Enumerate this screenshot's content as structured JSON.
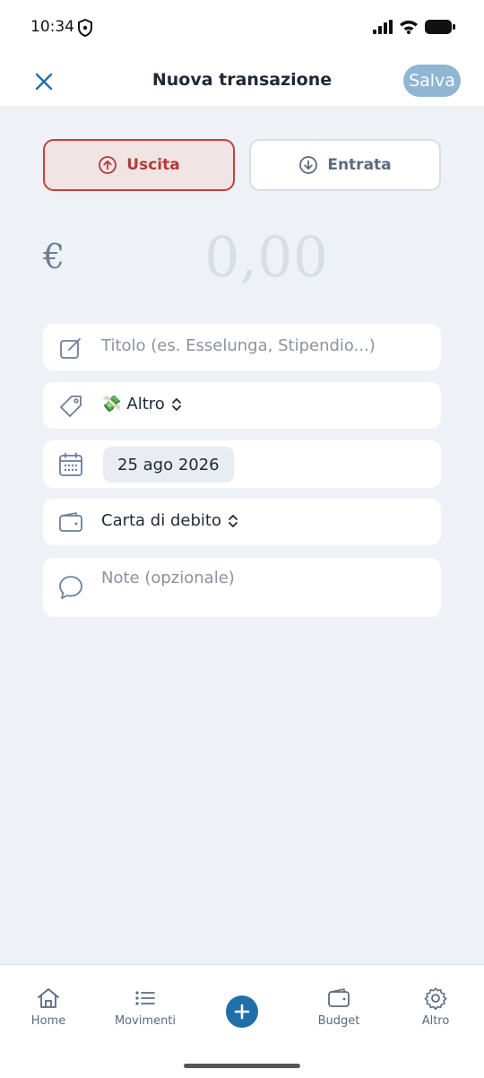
{
  "status_bar": {
    "time": "10:34"
  },
  "header": {
    "title": "Nuova transazione",
    "save_label": "Salva"
  },
  "type_toggle": {
    "expense_label": "Uscita",
    "income_label": "Entrata",
    "selected": "Uscita"
  },
  "amount": {
    "currency": "€",
    "value": "0,00"
  },
  "form": {
    "title_placeholder": "Titolo (es. Esselunga, Stipendio...)",
    "category": {
      "emoji": "💸",
      "label": "Altro"
    },
    "date": "25 ago 2026",
    "account": "Carta di debito",
    "notes_placeholder": "Note (opzionale)"
  },
  "nav": {
    "home": "Home",
    "transactions": "Movimenti",
    "budget": "Budget",
    "more": "Altro"
  },
  "colors": {
    "accent": "#1f6fa8",
    "expense": "#c4403f",
    "background": "#eef2f6"
  }
}
